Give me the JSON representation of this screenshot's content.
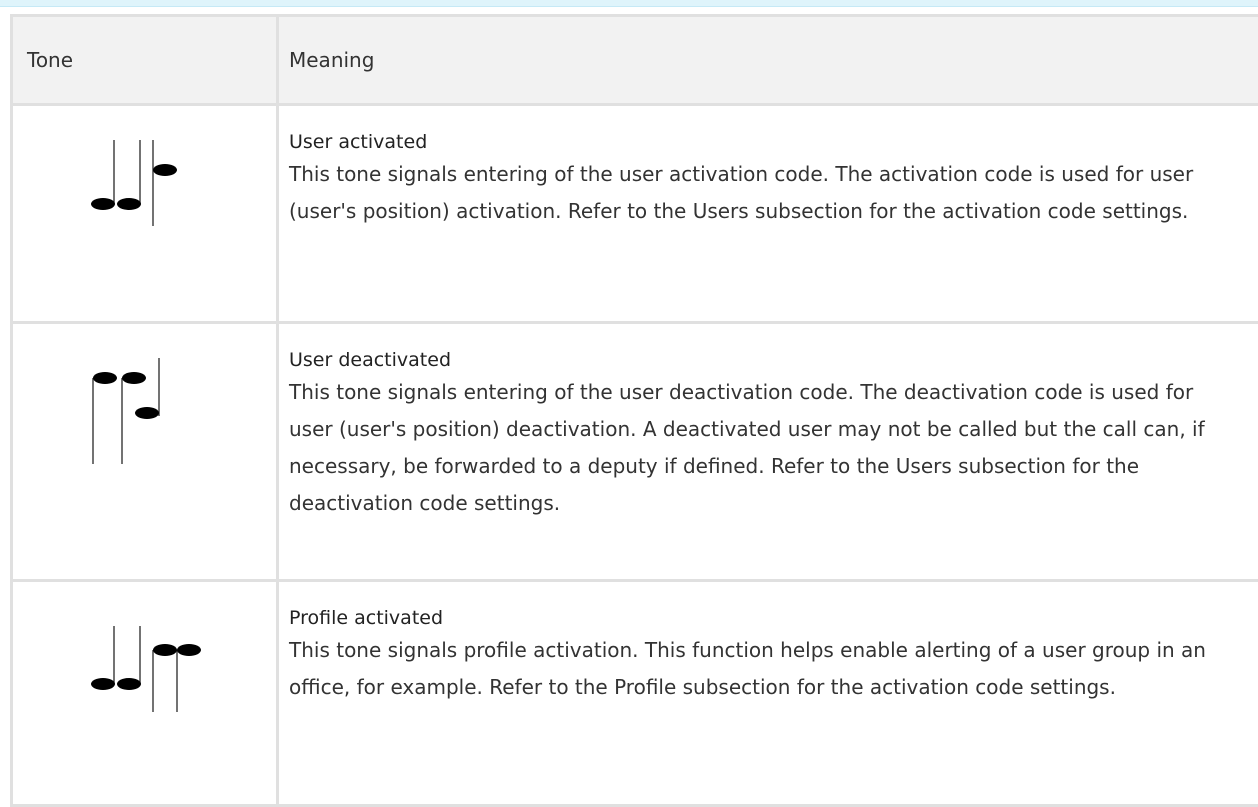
{
  "table": {
    "headers": {
      "tone": "Tone",
      "meaning": "Meaning"
    },
    "rows": [
      {
        "icon": "music-notes-ascending-icon",
        "title": "User activated",
        "description": "This tone signals entering of the user activation code. The activation code is used for user (user's position) activation. Refer to the Users subsection for the activation code settings."
      },
      {
        "icon": "music-notes-descending-icon",
        "title": "User deactivated",
        "description": "This tone signals entering of the user deactivation code. The deactivation code is used for user (user's position) deactivation. A deactivated user may not be called but the call can, if necessary, be forwarded to a deputy if defined. Refer to the Users subsection for the deactivation code settings."
      },
      {
        "icon": "music-notes-profile-icon",
        "title": "Profile activated",
        "description": "This tone signals profile activation. This function helps enable alerting of a user group in an office, for example. Refer to the Profile subsection for the activation code settings."
      }
    ]
  }
}
